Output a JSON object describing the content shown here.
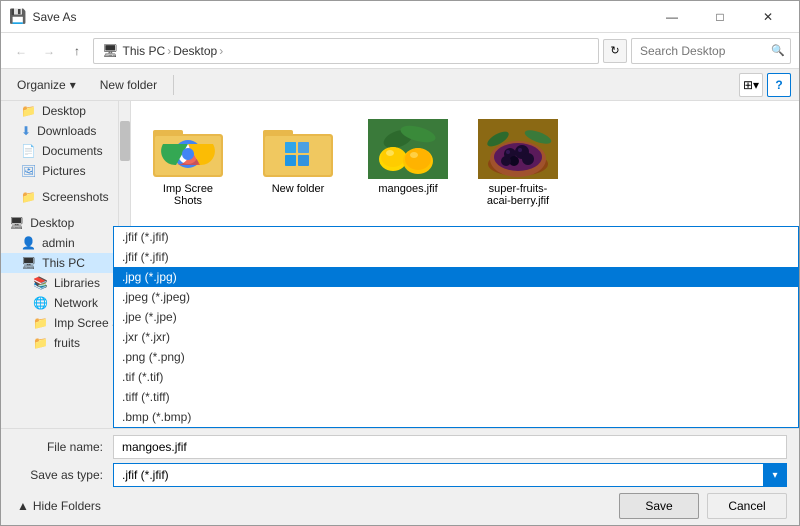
{
  "dialog": {
    "title": "Save As",
    "close_btn": "✕",
    "minimize_btn": "—",
    "maximize_btn": "□"
  },
  "addressbar": {
    "back_tooltip": "Back",
    "forward_tooltip": "Forward",
    "up_tooltip": "Up",
    "path": {
      "thispc": "This PC",
      "desktop": "Desktop"
    },
    "search_placeholder": "Search Desktop",
    "refresh_label": "⟳"
  },
  "toolbar": {
    "organize_label": "Organize",
    "new_folder_label": "New folder",
    "view_icon": "≡",
    "help_label": "?"
  },
  "sidebar": {
    "items": [
      {
        "label": "Desktop",
        "icon": "📁",
        "indent": 1
      },
      {
        "label": "Downloads",
        "icon": "⬇",
        "indent": 1
      },
      {
        "label": "Documents",
        "icon": "📄",
        "indent": 1
      },
      {
        "label": "Pictures",
        "icon": "🖼",
        "indent": 1
      },
      {
        "label": "",
        "indent": 1,
        "separator": true
      },
      {
        "label": "Screenshots",
        "icon": "📁",
        "indent": 1
      },
      {
        "label": "",
        "indent": 0,
        "separator": true
      },
      {
        "label": "Desktop",
        "icon": "🖥",
        "indent": 0
      },
      {
        "label": "admin",
        "icon": "👤",
        "indent": 1
      },
      {
        "label": "This PC",
        "icon": "🖥",
        "indent": 1,
        "selected": true
      },
      {
        "label": "Libraries",
        "icon": "📚",
        "indent": 2
      },
      {
        "label": "Network",
        "icon": "🌐",
        "indent": 2
      },
      {
        "label": "Imp Scree Shots",
        "icon": "📁",
        "indent": 2
      },
      {
        "label": "fruits",
        "icon": "📁",
        "indent": 2
      }
    ]
  },
  "files": [
    {
      "name": "Imp Scree Shots",
      "type": "folder"
    },
    {
      "name": "New folder",
      "type": "folder_win11"
    },
    {
      "name": "mangoes.jfif",
      "type": "image_mango"
    },
    {
      "name": "super-fruits-acai-berry.jfif",
      "type": "image_acai"
    }
  ],
  "bottom": {
    "filename_label": "File name:",
    "filename_value": "mangoes.jfif",
    "savetype_label": "Save as type:",
    "savetype_value": ".jfif (*.jfif)",
    "hide_folders_label": "Hide Folders",
    "save_btn": "Save",
    "cancel_btn": "Cancel"
  },
  "dropdown_options": [
    {
      "label": ".jfif (*.jfif)",
      "selected": false
    },
    {
      "label": ".jfif (*.jfif)",
      "selected": false
    },
    {
      "label": ".jpg (*.jpg)",
      "selected": true,
      "highlighted": true
    },
    {
      "label": ".jpeg (*.jpeg)",
      "selected": false
    },
    {
      "label": ".jpe (*.jpe)",
      "selected": false
    },
    {
      "label": ".jxr (*.jxr)",
      "selected": false
    },
    {
      "label": ".png (*.png)",
      "selected": false
    },
    {
      "label": ".tif (*.tif)",
      "selected": false
    },
    {
      "label": ".tiff (*.tiff)",
      "selected": false
    },
    {
      "label": ".bmp (*.bmp)",
      "selected": false
    }
  ]
}
